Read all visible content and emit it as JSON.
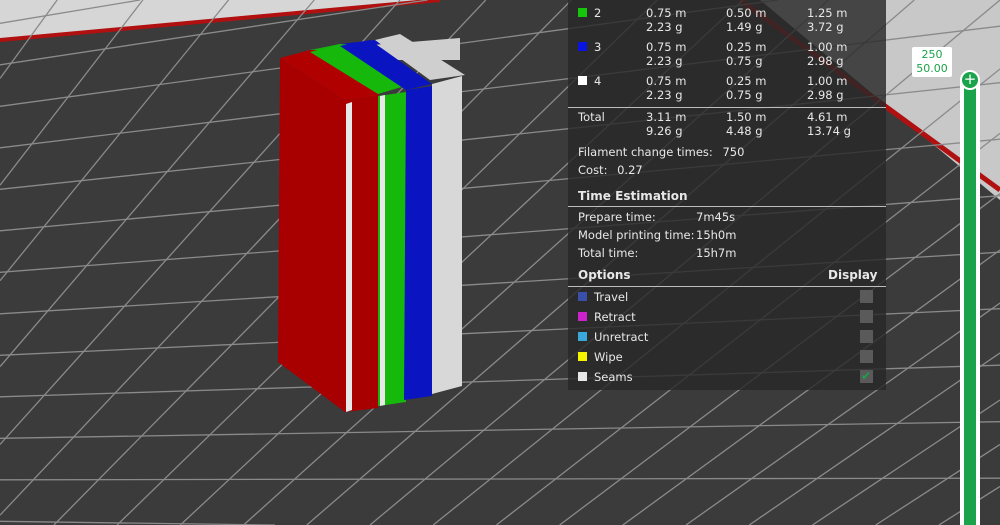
{
  "filament_table": {
    "rows": [
      {
        "id": "2",
        "color": "#16c60c",
        "m1": "0.75 m",
        "g1": "2.23 g",
        "m2": "0.50 m",
        "g2": "1.49 g",
        "m3": "1.25 m",
        "g3": "3.72 g"
      },
      {
        "id": "3",
        "color": "#0a14e0",
        "m1": "0.75 m",
        "g1": "2.23 g",
        "m2": "0.25 m",
        "g2": "0.75 g",
        "m3": "1.00 m",
        "g3": "2.98 g"
      },
      {
        "id": "4",
        "color": "#ffffff",
        "m1": "0.75 m",
        "g1": "2.23 g",
        "m2": "0.25 m",
        "g2": "0.75 g",
        "m3": "1.00 m",
        "g3": "2.98 g"
      }
    ],
    "total": {
      "label": "Total",
      "m1": "3.11 m",
      "g1": "9.26 g",
      "m2": "1.50 m",
      "g2": "4.48 g",
      "m3": "4.61 m",
      "g3": "13.74 g"
    },
    "filament_change_label": "Filament change times:",
    "filament_change_value": "750",
    "cost_label": "Cost:",
    "cost_value": "0.27"
  },
  "time": {
    "title": "Time Estimation",
    "prepare_label": "Prepare time:",
    "prepare_value": "7m45s",
    "model_label": "Model printing time:",
    "model_value": "15h0m",
    "total_label": "Total time:",
    "total_value": "15h7m"
  },
  "options": {
    "title": "Options",
    "display_title": "Display",
    "items": [
      {
        "label": "Travel",
        "color": "#3a4fa8",
        "checked": false
      },
      {
        "label": "Retract",
        "color": "#cc22cc",
        "checked": false
      },
      {
        "label": "Unretract",
        "color": "#3aa8d8",
        "checked": false
      },
      {
        "label": "Wipe",
        "color": "#f5f500",
        "checked": false
      },
      {
        "label": "Seams",
        "color": "#e8e8e8",
        "checked": true
      }
    ]
  },
  "slider": {
    "layer": "250",
    "height": "50.00"
  }
}
